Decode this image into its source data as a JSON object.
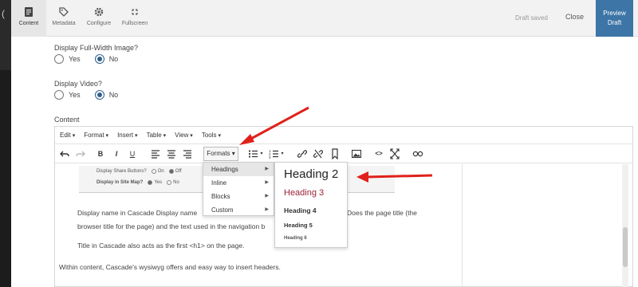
{
  "topbar": {
    "modes": [
      {
        "label": "Content",
        "icon": "document-icon",
        "active": true
      },
      {
        "label": "Metadata",
        "icon": "tag-icon",
        "active": false
      },
      {
        "label": "Configure",
        "icon": "gear-icon",
        "active": false
      },
      {
        "label": "Fullscreen",
        "icon": "fullscreen-icon",
        "active": false
      }
    ],
    "draft_saved": "Draft saved",
    "close_label": "Close",
    "preview_line1": "Preview",
    "preview_line2": "Draft",
    "accent_color": "#3d75a6"
  },
  "form": {
    "full_width_image": {
      "label": "Display Full-Width Image?",
      "yes": "Yes",
      "no": "No",
      "selected": "No"
    },
    "video": {
      "label": "Display Video?",
      "yes": "Yes",
      "no": "No",
      "selected": "No"
    },
    "content_label": "Content"
  },
  "editor": {
    "menus": [
      "Edit",
      "Format",
      "Insert",
      "Table",
      "View",
      "Tools"
    ],
    "formats_label": "Formats",
    "formats_items": [
      {
        "label": "Headings",
        "active": true
      },
      {
        "label": "Inline",
        "active": false
      },
      {
        "label": "Blocks",
        "active": false
      },
      {
        "label": "Custom",
        "active": false
      }
    ],
    "headings": [
      "Heading 2",
      "Heading 3",
      "Heading 4",
      "Heading 5",
      "Heading 6"
    ],
    "heading3_color": "#9b2335",
    "embedded": {
      "share_label": "Display Share Buttons?",
      "share_on": "On",
      "share_off": "Off",
      "sitemap_label": "Display in Site Map?",
      "sitemap_yes": "Yes",
      "sitemap_no": "No"
    },
    "paragraph1_left": "Display name in Cascade Display name",
    "paragraph1_right": "Does the page title (the",
    "paragraph1_line2": "browser title for the page) and the text used in the navigation b",
    "paragraph2": "Title in Cascade also acts as the first <h1> on the page.",
    "paragraph3": "Within content, Cascade's wysiwyg offers and easy way to insert headers."
  },
  "annotations": {
    "arrow_color": "#e0201b"
  }
}
